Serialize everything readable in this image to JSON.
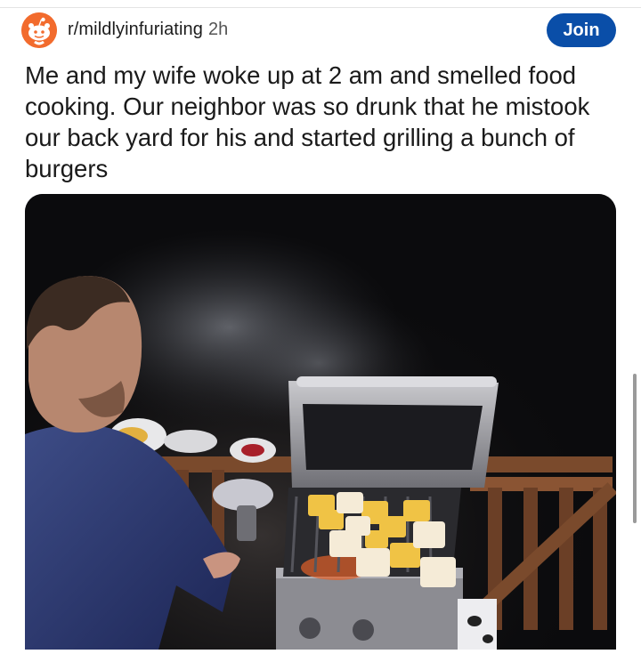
{
  "post": {
    "subreddit": "r/mildlyinfuriating",
    "time": "2h",
    "join_label": "Join",
    "title": "Me and my wife woke up at 2 am and smelled food cooking. Our neighbor was so drunk that he mistook our back yard for his and started grilling a bunch of burgers",
    "avatar_icon": "reddit-snoo-icon"
  },
  "colors": {
    "join_button": "#0a4ea8",
    "avatar": "#f26b2d"
  }
}
